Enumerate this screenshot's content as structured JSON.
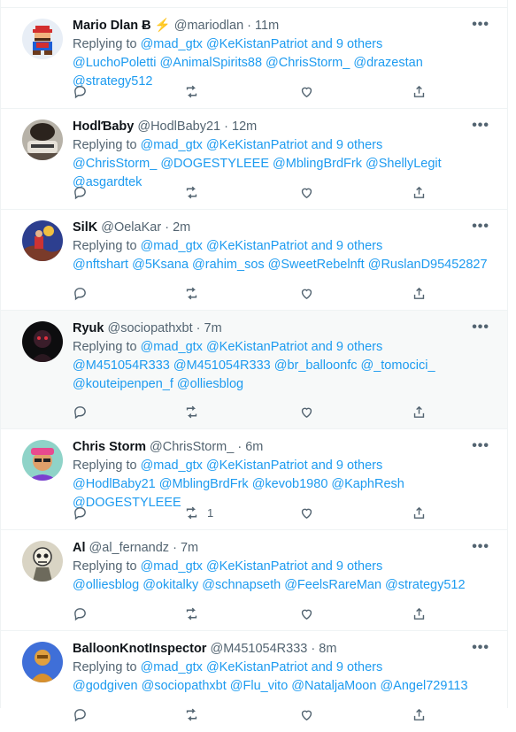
{
  "reply_prefix": "Replying to",
  "reply_link": "@mad_gtx @KeKistanPatriot and 9 others",
  "tweets": [
    {
      "name": "Mario Dlan Ƀ",
      "emoji": "⚡",
      "handle": "@mariodlan",
      "time": "11m",
      "mentions": [
        "@LuchoPoletti @AnimalSpirits88 @ChrisStorm_ @drazestan @strategy512"
      ],
      "retweets": ""
    },
    {
      "name": "HodlƁaby",
      "emoji": "",
      "handle": "@HodlBaby21",
      "time": "12m",
      "mentions": [
        "@ChrisStorm_ @DOGESTYLEEE @MblingBrdFrk @ShellyLegit @asgardtek"
      ],
      "retweets": ""
    },
    {
      "name": "SilK",
      "emoji": "",
      "handle": "@OelaKar",
      "time": "2m",
      "mentions": [
        "@nftshart @5Ksana @rahim_sos @SweetRebelnft @RuslanD95452827"
      ],
      "retweets": ""
    },
    {
      "name": "Ryuk",
      "emoji": "",
      "handle": "@sociopathxbt",
      "time": "7m",
      "mentions": [
        "@M451054R333 @M451054R333 @br_balloonfc @_tomocici_",
        "@kouteipenpen_f @olliesblog"
      ],
      "retweets": ""
    },
    {
      "name": "Chris Storm",
      "emoji": "",
      "handle": "@ChrisStorm_",
      "time": "6m",
      "mentions": [
        "@HodlBaby21 @MblingBrdFrk @kevob1980 @KaphResh @DOGESTYLEEE"
      ],
      "retweets": "1"
    },
    {
      "name": "Al",
      "emoji": "",
      "handle": "@al_fernandz",
      "time": "7m",
      "mentions": [
        "@olliesblog @okitalky @schnapseth @FeelsRareMan @strategy512"
      ],
      "retweets": ""
    },
    {
      "name": "BalloonKnotInspector",
      "emoji": "",
      "handle": "@M451054R333",
      "time": "8m",
      "mentions": [
        "@godgiven @sociopathxbt @Flu_vito @NataljaMoon @Angel729113"
      ],
      "retweets": ""
    }
  ],
  "icons": {
    "reply": "reply-icon",
    "retweet": "retweet-icon",
    "like": "like-icon",
    "share": "share-icon",
    "more": "more-icon"
  },
  "colors": {
    "link": "#1d9bf0",
    "muted": "#536471",
    "text": "#0f1419",
    "highlight": "#f7f9f9"
  }
}
